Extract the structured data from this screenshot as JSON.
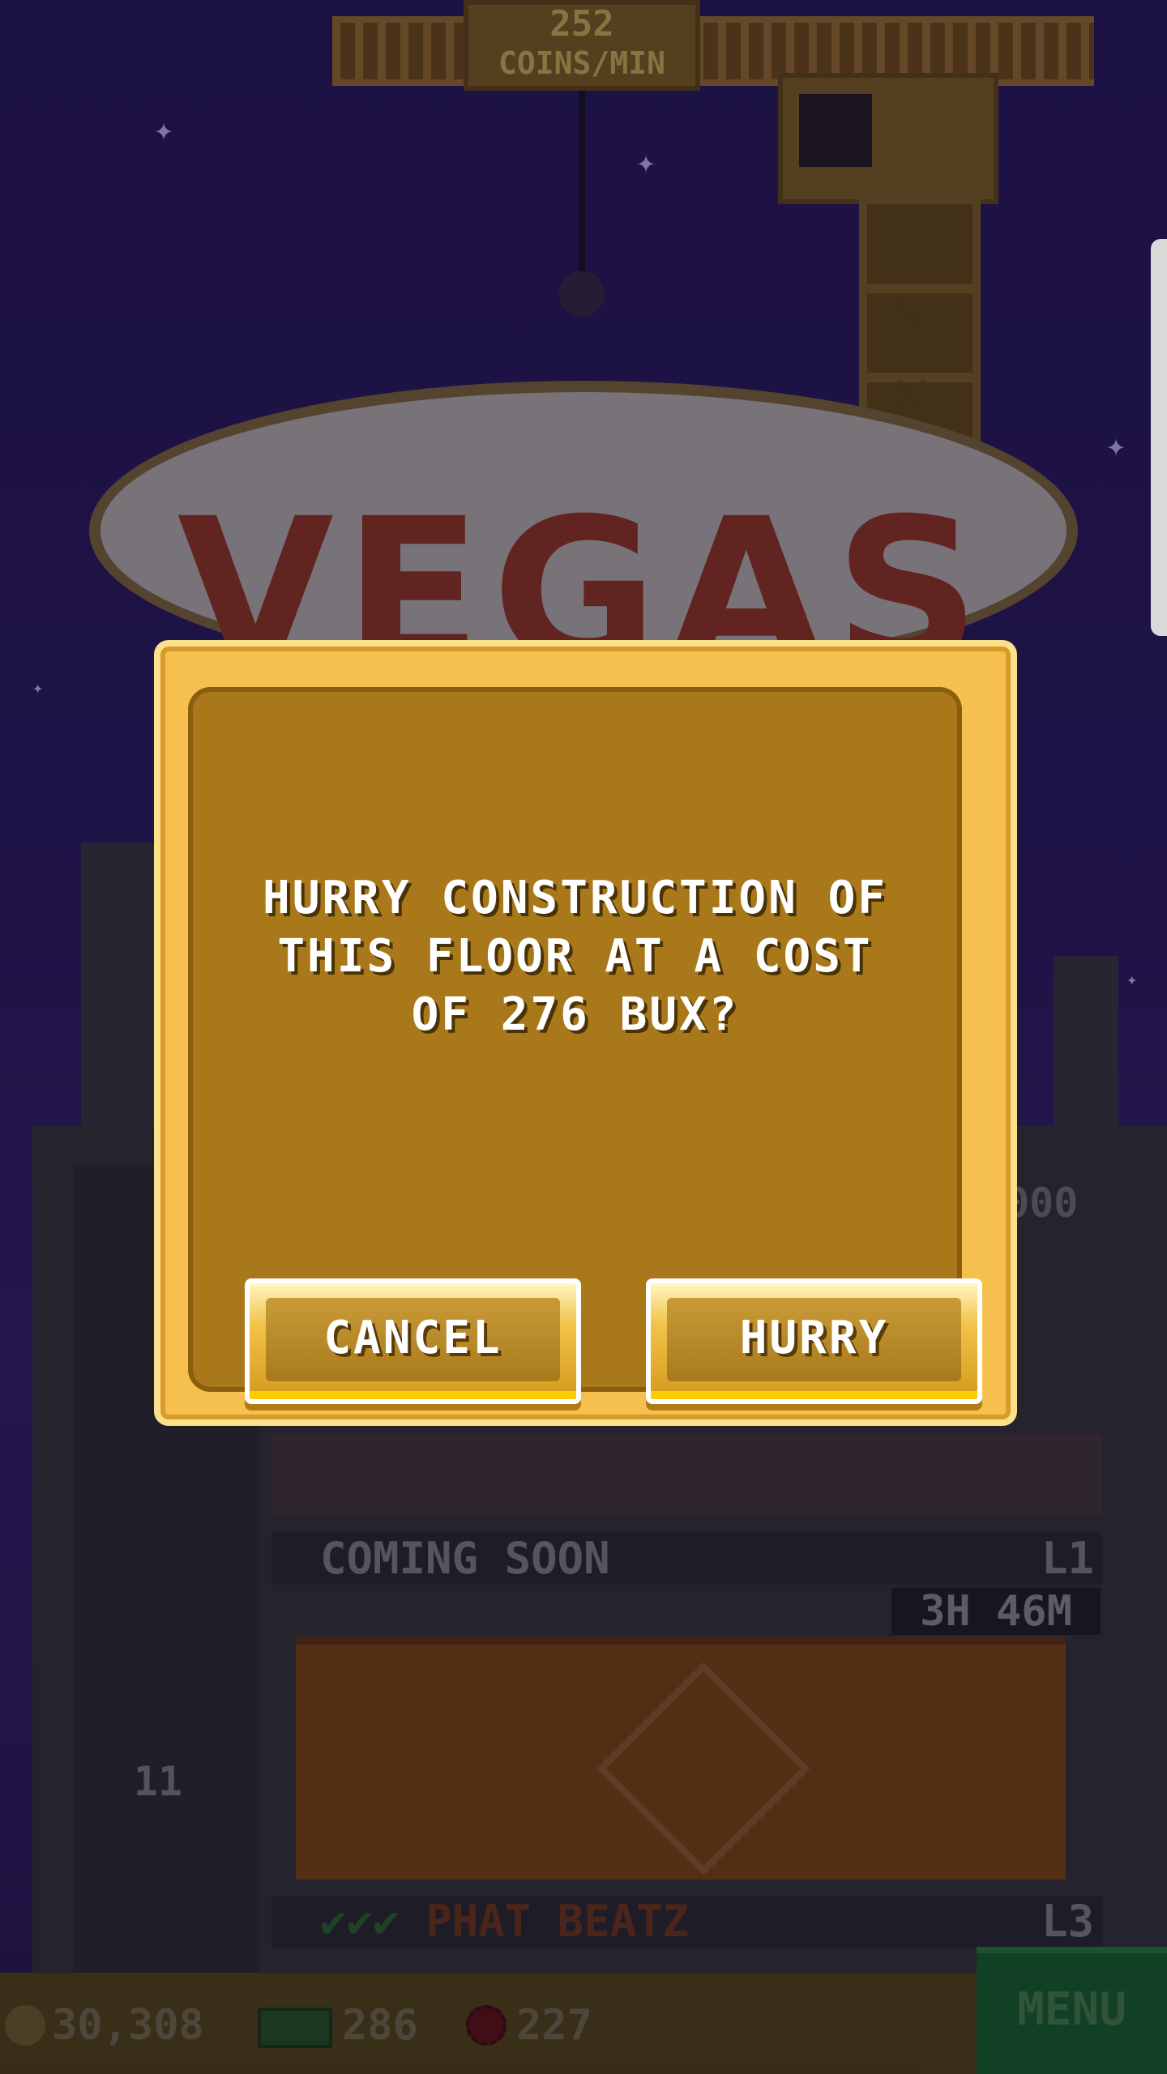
{
  "hud": {
    "coin_rate_value": "252",
    "coin_rate_label": "COINS/MIN"
  },
  "background": {
    "sign_text": "VEGAS",
    "floor_labels": [
      {
        "name": "COMING SOON",
        "level": "L1"
      },
      {
        "name": "PHAT BEATZ",
        "level": "L3"
      }
    ],
    "timer": "3H 46M",
    "elevator_floor": "11",
    "partial_value": "000"
  },
  "dialog": {
    "message": "HURRY CONSTRUCTION OF THIS FLOOR AT A COST OF 276 BUX?",
    "cancel_label": "CANCEL",
    "hurry_label": "HURRY"
  },
  "bottom_bar": {
    "coins": "30,308",
    "bux": "286",
    "chips": "227",
    "menu_label": "MENU"
  },
  "colors": {
    "dialog_outer": "#f6c04e",
    "dialog_inner": "#a8781a",
    "sky": "#2f1d63",
    "menu": "#176a2a"
  }
}
